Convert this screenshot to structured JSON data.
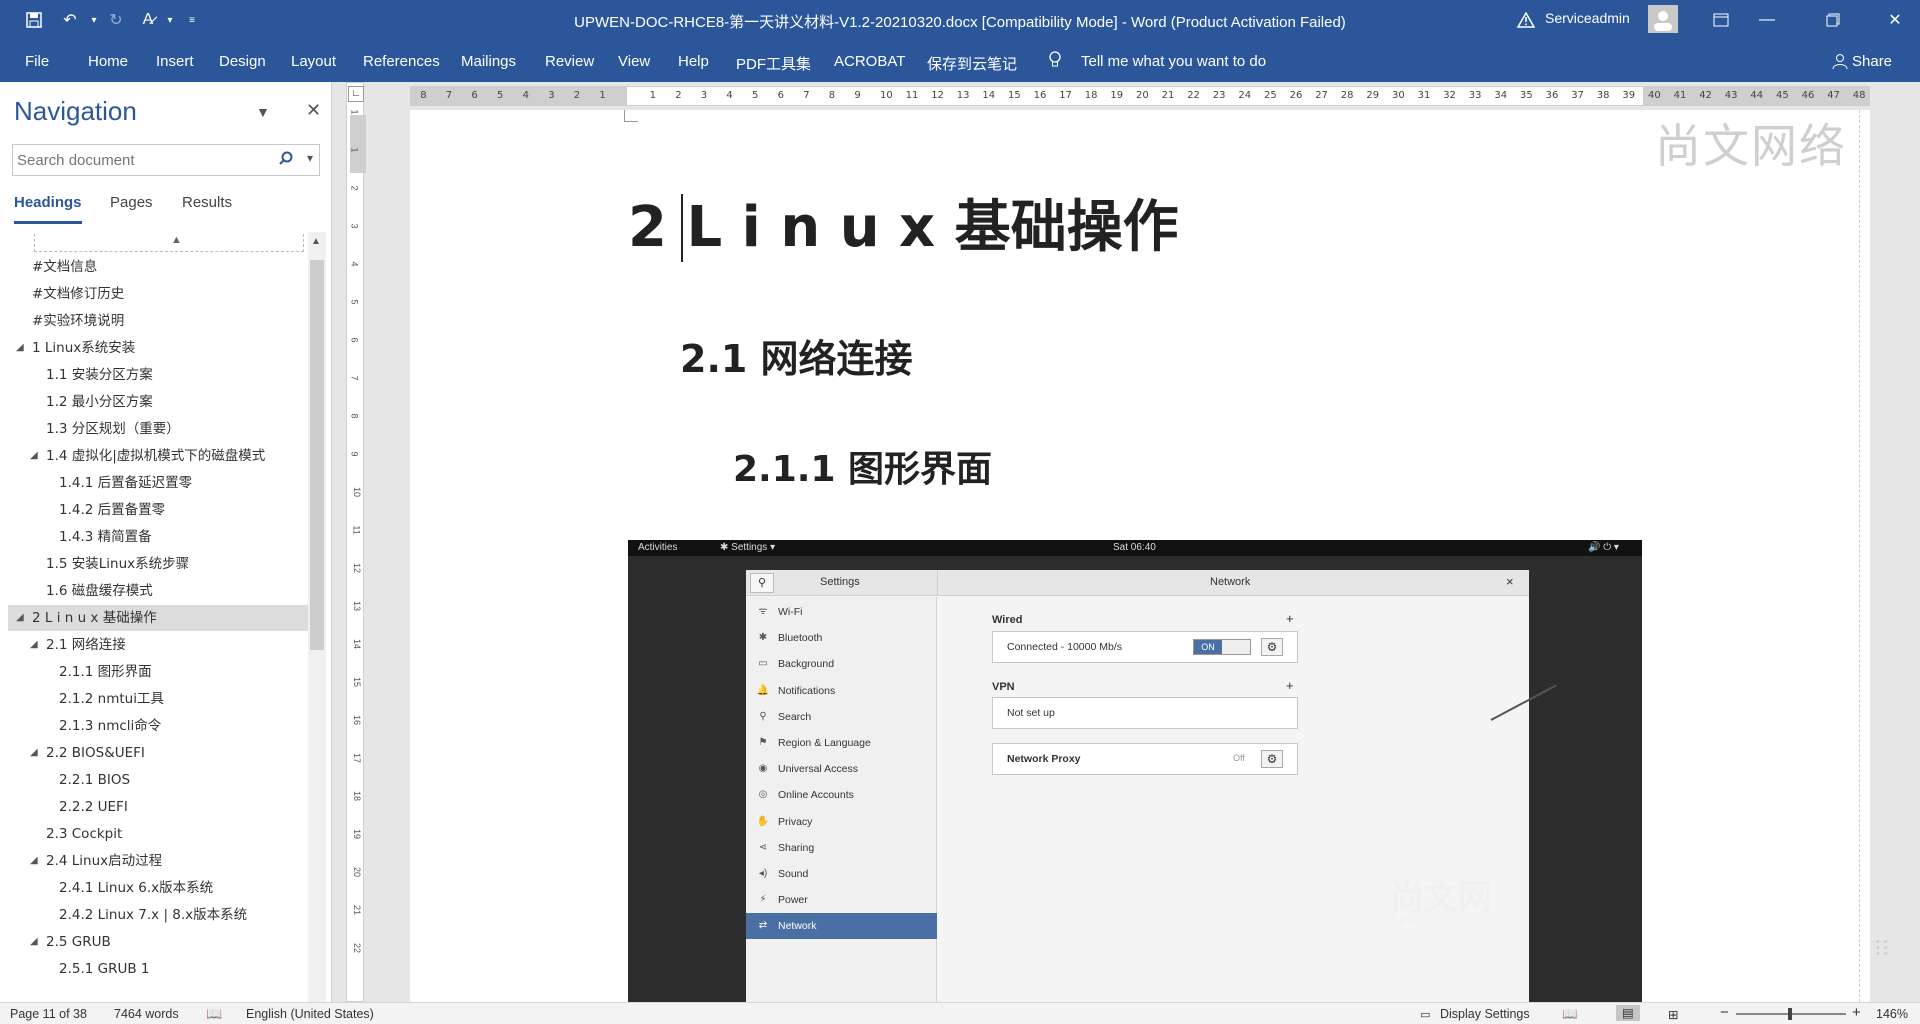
{
  "window": {
    "title": "UPWEN-DOC-RHCE8-第一天讲义材料-V1.2-20210320.docx [Compatibility Mode]  -  Word (Product Activation Failed)",
    "user": "Serviceadmin",
    "warning_icon": "warning-icon"
  },
  "ribbon": {
    "tabs": [
      "File",
      "Home",
      "Insert",
      "Design",
      "Layout",
      "References",
      "Mailings",
      "Review",
      "View",
      "Help",
      "PDF工具集",
      "ACROBAT",
      "保存到云笔记"
    ],
    "tell_me": "Tell me what you want to do",
    "share": "Share"
  },
  "navigation": {
    "title": "Navigation",
    "search_placeholder": "Search document",
    "tabs": [
      "Headings",
      "Pages",
      "Results"
    ],
    "active_tab": "Headings",
    "headings": [
      {
        "text": "#文档信息",
        "level": 1,
        "expand": ""
      },
      {
        "text": "#文档修订历史",
        "level": 1,
        "expand": ""
      },
      {
        "text": "#实验环境说明",
        "level": 1,
        "expand": ""
      },
      {
        "text": "1 Linux系统安装",
        "level": 1,
        "expand": "◢"
      },
      {
        "text": "1.1 安装分区方案",
        "level": 2,
        "expand": ""
      },
      {
        "text": "1.2 最小分区方案",
        "level": 2,
        "expand": ""
      },
      {
        "text": "1.3 分区规划（重要）",
        "level": 2,
        "expand": ""
      },
      {
        "text": "1.4 虚拟化|虚拟机模式下的磁盘模式",
        "level": 2,
        "expand": "◢"
      },
      {
        "text": "1.4.1 后置备延迟置零",
        "level": 3,
        "expand": ""
      },
      {
        "text": "1.4.2 后置备置零",
        "level": 3,
        "expand": ""
      },
      {
        "text": "1.4.3 精简置备",
        "level": 3,
        "expand": ""
      },
      {
        "text": "1.5 安装Linux系统步骤",
        "level": 2,
        "expand": ""
      },
      {
        "text": "1.6 磁盘缓存模式",
        "level": 2,
        "expand": ""
      },
      {
        "text": "2 L i n u x 基础操作",
        "level": 1,
        "expand": "◢",
        "selected": true
      },
      {
        "text": "2.1 网络连接",
        "level": 2,
        "expand": "◢"
      },
      {
        "text": "2.1.1 图形界面",
        "level": 3,
        "expand": ""
      },
      {
        "text": "2.1.2 nmtui工具",
        "level": 3,
        "expand": ""
      },
      {
        "text": "2.1.3 nmcli命令",
        "level": 3,
        "expand": ""
      },
      {
        "text": "2.2 BIOS&UEFI",
        "level": 2,
        "expand": "◢"
      },
      {
        "text": "2.2.1  BIOS",
        "level": 3,
        "expand": ""
      },
      {
        "text": "2.2.2  UEFI",
        "level": 3,
        "expand": ""
      },
      {
        "text": "2.3 Cockpit",
        "level": 2,
        "expand": ""
      },
      {
        "text": "2.4 Linux启动过程",
        "level": 2,
        "expand": "◢"
      },
      {
        "text": "2.4.1  Linux 6.x版本系统",
        "level": 3,
        "expand": ""
      },
      {
        "text": "2.4.2  Linux 7.x | 8.x版本系统",
        "level": 3,
        "expand": ""
      },
      {
        "text": "2.5 GRUB",
        "level": 2,
        "expand": "◢"
      },
      {
        "text": "2.5.1 GRUB 1",
        "level": 3,
        "expand": ""
      }
    ]
  },
  "ruler": {
    "left_ticks": [
      "8",
      "7",
      "6",
      "5",
      "4",
      "3",
      "2",
      "1"
    ],
    "right_ticks": [
      "1",
      "2",
      "3",
      "4",
      "5",
      "6",
      "7",
      "8",
      "9",
      "10",
      "11",
      "12",
      "13",
      "14",
      "15",
      "16",
      "17",
      "18",
      "19",
      "20",
      "21",
      "22",
      "23",
      "24",
      "25",
      "26",
      "27",
      "28",
      "29",
      "30",
      "31",
      "32",
      "33",
      "34",
      "35",
      "36",
      "37",
      "38",
      "39",
      "40",
      "41",
      "42",
      "43",
      "44",
      "45",
      "46",
      "47",
      "48"
    ],
    "vertical_ticks": [
      "1",
      "1",
      "2",
      "3",
      "4",
      "5",
      "6",
      "7",
      "8",
      "9",
      "10",
      "11",
      "12",
      "13",
      "14",
      "15",
      "16",
      "17",
      "18",
      "19",
      "20",
      "21",
      "22"
    ]
  },
  "document": {
    "h1": "2 L i n u x  基础操作",
    "h2": "2.1 网络连接",
    "h3": "2.1.1 图形界面",
    "watermark": "尚文网络"
  },
  "screenshot": {
    "topbar": {
      "activities": "Activities",
      "app": "✱ Settings ▾",
      "time": "Sat 06:40",
      "tray": "🔊  ⏻ ▾"
    },
    "settings_title": "Settings",
    "panel_title": "Network",
    "close": "×",
    "sidebar": [
      {
        "icon": "ᯤ",
        "label": "Wi-Fi"
      },
      {
        "icon": "✱",
        "label": "Bluetooth"
      },
      {
        "icon": "▭",
        "label": "Background"
      },
      {
        "icon": "🔔",
        "label": "Notifications"
      },
      {
        "icon": "⚲",
        "label": "Search"
      },
      {
        "icon": "⚑",
        "label": "Region & Language"
      },
      {
        "icon": "◉",
        "label": "Universal Access"
      },
      {
        "icon": "◎",
        "label": "Online Accounts"
      },
      {
        "icon": "✋",
        "label": "Privacy"
      },
      {
        "icon": "⋖",
        "label": "Sharing"
      },
      {
        "icon": "◂)",
        "label": "Sound"
      },
      {
        "icon": "⚡",
        "label": "Power"
      },
      {
        "icon": "⇄",
        "label": "Network",
        "active": true
      }
    ],
    "wired": {
      "title": "Wired",
      "status": "Connected - 10000 Mb/s",
      "toggle": "ON"
    },
    "vpn": {
      "title": "VPN",
      "status": "Not set up"
    },
    "proxy": {
      "title": "Network Proxy",
      "status": "Off"
    },
    "watermark": "尚文网",
    "watermark_sub": "Linux"
  },
  "statusbar": {
    "page": "Page 11 of 38",
    "words": "7464 words",
    "language": "English (United States)",
    "display_settings": "Display Settings",
    "zoom": "146%"
  }
}
